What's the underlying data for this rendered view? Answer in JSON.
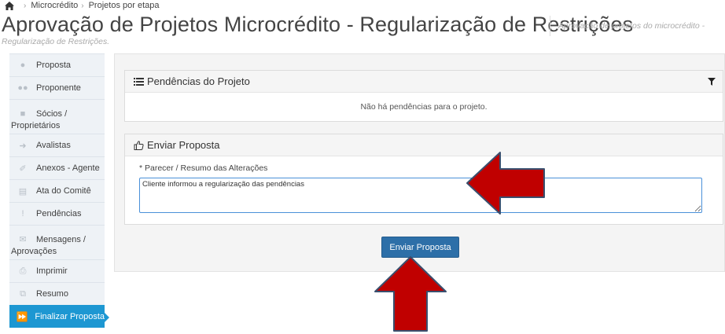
{
  "breadcrumb": {
    "home_icon": "home-icon",
    "items": [
      "Microcrédito",
      "Projetos por etapa"
    ]
  },
  "header": {
    "title": "Aprovação de Projetos Microcrédito - Regularização de Restrições",
    "subtitle_line1": "Aprovação de projetos do microcrédito -",
    "subtitle_line2": "Regularização de Restrições."
  },
  "sidebar": {
    "items": [
      {
        "label": "Proposta",
        "icon": "user-icon"
      },
      {
        "label": "Proponente",
        "icon": "users-icon"
      },
      {
        "label": "Sócios /",
        "label2": "Proprietários",
        "icon": "lock-icon"
      },
      {
        "label": "Avalistas",
        "icon": "sign-in-icon"
      },
      {
        "label": "Anexos - Agente",
        "icon": "paperclip-icon"
      },
      {
        "label": "Ata do Comitê",
        "icon": "document-icon"
      },
      {
        "label": "Pendências",
        "icon": "exclamation-icon"
      },
      {
        "label": "Mensagens /",
        "label2": "Aprovações",
        "icon": "envelope-icon"
      },
      {
        "label": "Imprimir",
        "icon": "print-icon"
      },
      {
        "label": "Resumo",
        "icon": "copy-icon"
      },
      {
        "label": "Finalizar Proposta",
        "icon": "fast-forward-icon",
        "active": true
      }
    ]
  },
  "pendencias": {
    "title": "Pendências do Projeto",
    "empty_message": "Não há pendências para o projeto."
  },
  "enviar": {
    "title": "Enviar Proposta",
    "field_label": "* Parecer / Resumo das Alterações",
    "field_value": "Cliente informou a regularização das pendências",
    "button_label": "Enviar Proposta"
  },
  "colors": {
    "accent": "#1d97d2",
    "button": "#2d6fa8",
    "annotation_arrow": "#c00000"
  }
}
